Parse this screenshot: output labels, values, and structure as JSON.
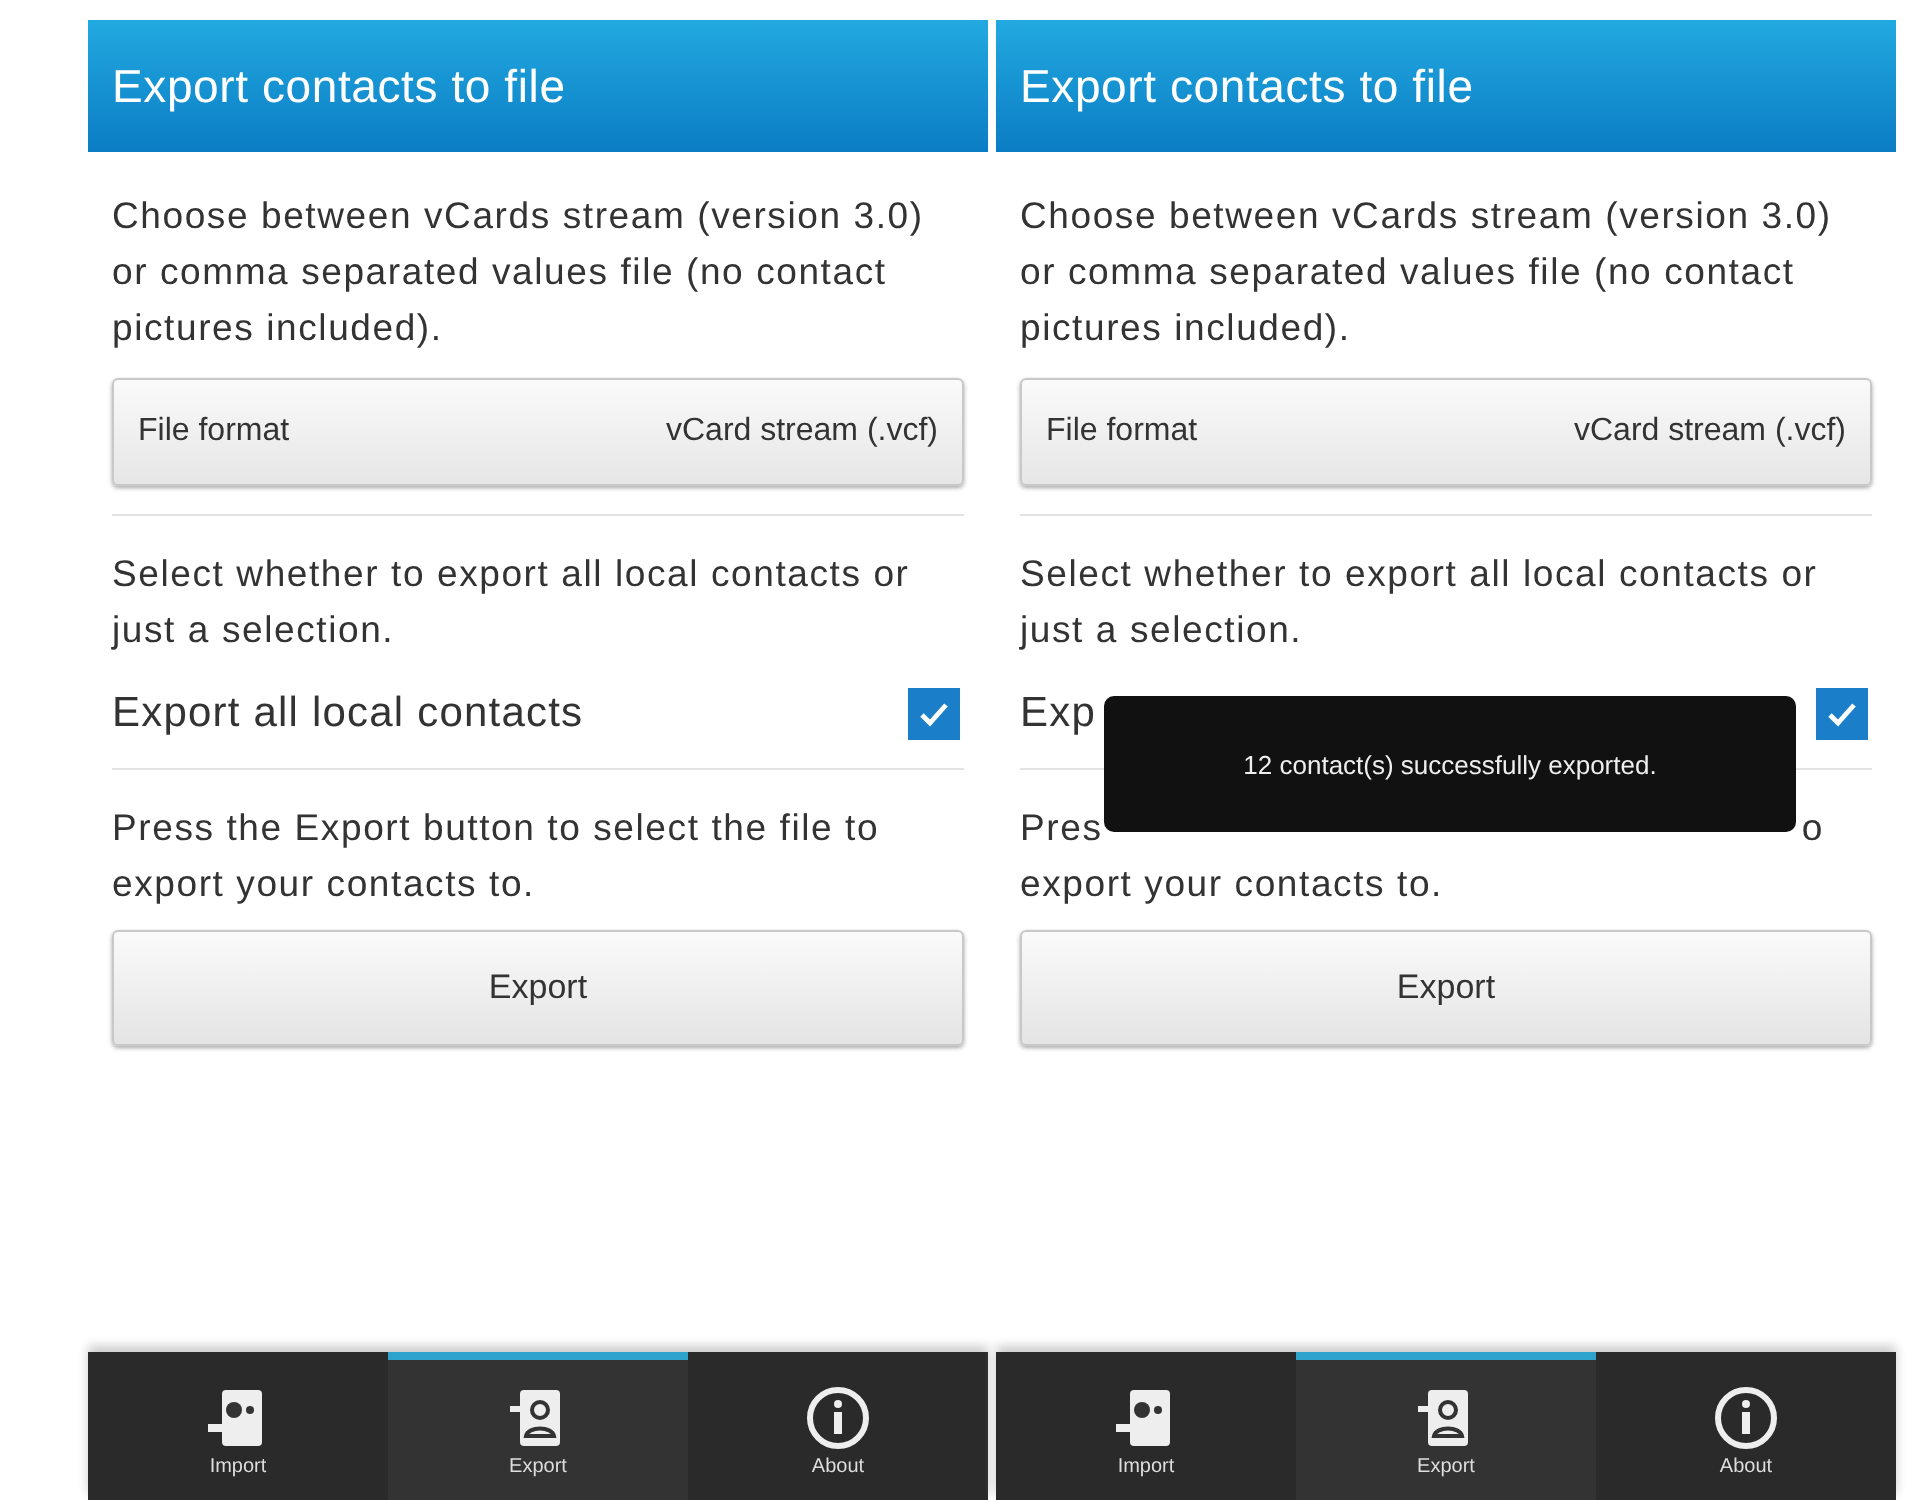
{
  "screens": [
    {
      "title": "Export contacts to file",
      "description": "Choose between vCards stream (version 3.0) or comma separated values file (no contact pictures included).",
      "file_format": {
        "label": "File format",
        "value": "vCard stream (.vcf)"
      },
      "selection_text": "Select whether to export all local contacts or just a selection.",
      "checkbox": {
        "label": "Export all local contacts",
        "checked": true
      },
      "export_prompt": [
        [
          "Press the Export button to select the file to"
        ],
        [
          "export your contacts to."
        ]
      ],
      "button": "Export",
      "tabs": [
        {
          "label": "Import",
          "kind": "import",
          "selected": false
        },
        {
          "label": "Export",
          "kind": "export",
          "selected": true
        },
        {
          "label": "About",
          "kind": "about",
          "selected": false
        }
      ]
    },
    {
      "title": "Export contacts to file",
      "description": "Choose between vCards stream (version 3.0) or comma separated values file (no contact pictures included).",
      "file_format": {
        "label": "File format",
        "value": "vCard stream (.vcf)"
      },
      "selection_text": "Select whether to export all local contacts or just a selection.",
      "checkbox": {
        "label": "Exp",
        "checked": true
      },
      "export_prompt": [
        [
          "Pres",
          "o"
        ],
        [
          "export your contacts to."
        ]
      ],
      "button": "Export",
      "toast": "12 contact(s) successfully exported.",
      "tabs": [
        {
          "label": "Import",
          "kind": "import",
          "selected": false
        },
        {
          "label": "Export",
          "kind": "export",
          "selected": true
        },
        {
          "label": "About",
          "kind": "about",
          "selected": false
        }
      ]
    }
  ]
}
